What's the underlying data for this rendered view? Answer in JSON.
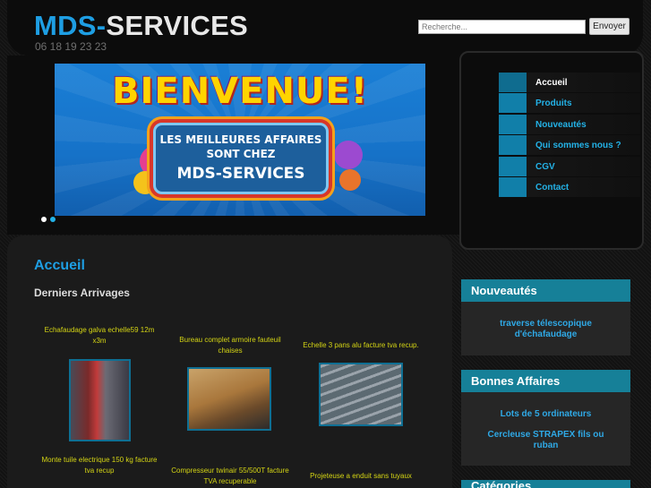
{
  "header": {
    "logo_part1": "MDS-",
    "logo_part2": "SERVICES",
    "phone": "06 18 19 23 23",
    "search_placeholder": "Recherche...",
    "search_button": "Envoyer"
  },
  "banner": {
    "welcome": "BIENVENUE!",
    "line1": "LES MEILLEURES AFFAIRES",
    "line2": "SONT CHEZ",
    "line3": "MDS-SERVICES",
    "slide_count": 2,
    "active_slide": 2
  },
  "nav": {
    "items": [
      {
        "label": "Accueil",
        "active": true
      },
      {
        "label": "Produits",
        "active": false
      },
      {
        "label": "Nouveautés",
        "active": false
      },
      {
        "label": "Qui sommes nous ?",
        "active": false
      },
      {
        "label": "CGV",
        "active": false
      },
      {
        "label": "Contact",
        "active": false
      }
    ]
  },
  "main": {
    "page_title": "Accueil",
    "section_title": "Derniers Arrivages",
    "products": [
      {
        "caption": "Echafaudage galva echelle59 12m x3m"
      },
      {
        "caption": "Bureau complet armoire fauteuil chaises"
      },
      {
        "caption": "Echelle 3 pans alu facture tva recup."
      },
      {
        "caption": "Monte tuile electrique 150 kg facture tva recup"
      },
      {
        "caption": "Compresseur twinair 55/500T facture TVA recuperable"
      },
      {
        "caption": "Projeteuse a enduit sans tuyaux"
      }
    ]
  },
  "sidebar": {
    "nouveautes": {
      "title": "Nouveautés",
      "links": [
        "traverse télescopique d'échafaudage"
      ]
    },
    "bonnes_affaires": {
      "title": "Bonnes Affaires",
      "links": [
        "Lots de 5 ordinateurs",
        "Cercleuse STRAPEX fils ou ruban"
      ]
    },
    "third_box_title": "Catégories"
  },
  "colors": {
    "accent": "#1e9ee3",
    "nav_square": "#117fa9",
    "box_header": "#168098",
    "caption": "#d4d414"
  }
}
